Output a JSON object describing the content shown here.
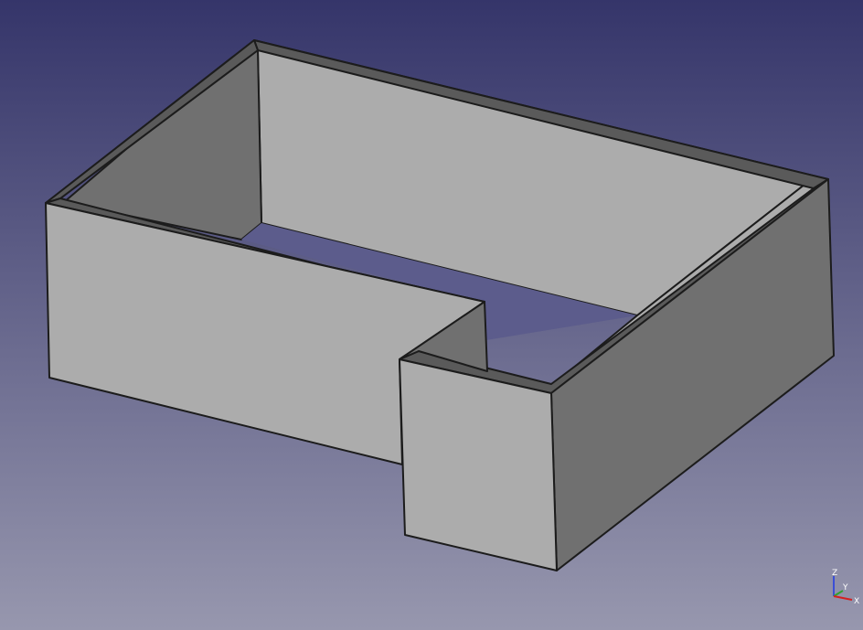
{
  "viewport": {
    "background_top": "#35356a",
    "background_bottom": "#9797ae"
  },
  "model": {
    "face_light": "#b0b0b0",
    "face_mid": "#a9a9a9",
    "face_dark": "#707070",
    "edge_color": "#1c1c1c"
  },
  "axis": {
    "z_label": "Z",
    "y_label": "Y",
    "x_label": "X",
    "z_color": "#3b4fd6",
    "y_color": "#2fa32f",
    "x_color": "#d42020"
  }
}
